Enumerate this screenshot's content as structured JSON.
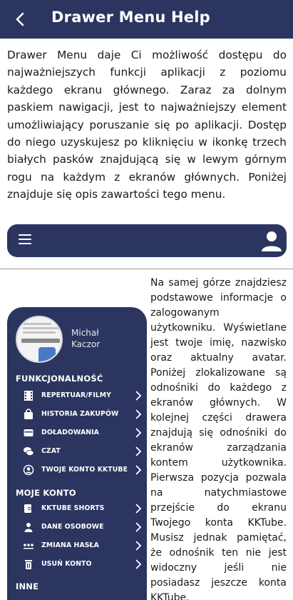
{
  "appbar": {
    "title": "Drawer Menu Help",
    "back_icon": "back-arrow-icon"
  },
  "intro": "Drawer Menu daje Ci możliwość dostępu do najważniejszych funkcji aplikacji z poziomu każdego ekranu głównego. Zaraz za dolnym paskiem nawigacji, jest to najważniejszy element umożliwiający poruszanie się po aplikacji. Dostęp do niego uzyskujesz po kliknięciu w ikonkę trzech białych pasków znajdującą się w lewym górnym rogu na każdym z ekranów głównych. Poniżej znajduje się opis zawartości tego menu.",
  "colors": {
    "primary": "#2b3560",
    "text": "#1a1a1a",
    "on_primary": "#ffffff"
  },
  "drawer": {
    "user_first": "Michał",
    "user_last": "Kaczor",
    "sections": {
      "features": "FUNKCJONALNOŚĆ",
      "account": "MOJE KONTO",
      "other": "INNE"
    },
    "feature_items": [
      {
        "label": "REPERTUAR/FILMY",
        "icon": "film-icon"
      },
      {
        "label": "HISTORIA ZAKUPÓW",
        "icon": "shopping-bag-icon"
      },
      {
        "label": "DOŁADOWANIA",
        "icon": "wallet-icon"
      },
      {
        "label": "CZAT",
        "icon": "chat-icon"
      },
      {
        "label": "TWOJE KONTO KKTUBE",
        "icon": "account-circle-icon"
      }
    ],
    "account_items": [
      {
        "label": "KKTUBE SHORTS",
        "icon": "shorts-icon"
      },
      {
        "label": "DANE OSOBOWE",
        "icon": "person-icon"
      },
      {
        "label": "ZMIANA HASŁA",
        "icon": "password-dots-icon"
      },
      {
        "label": "USUŃ KONTO",
        "icon": "trash-icon"
      }
    ]
  },
  "description": "Na samej górze znajdziesz podstawowe informacje o zalogowanym użytkowniku. Wyświetlane jest twoje imię, nazwisko oraz aktualny avatar. Poniżej zlokalizowane są odnośniki do każdego z ekranów głównych. W kolejnej części drawera znajdują się odnośniki do ekranów zarządzania kontem użytkownika. Pierwsza pozycja pozwala na natychmiastowe przejście do ekranu Twojego konta KKTube. Musisz jednak pamiętać, że odnośnik ten nie jest widoczny jeśli nie posiadasz jeszcze konta KKTube."
}
